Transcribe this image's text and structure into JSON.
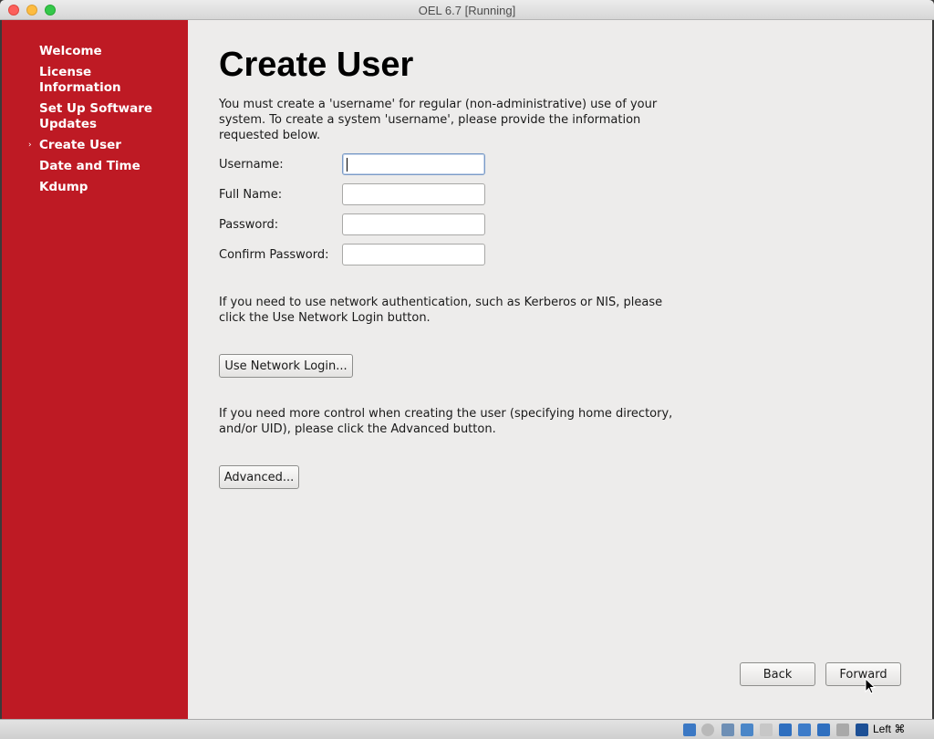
{
  "window": {
    "title": "OEL 6.7 [Running]"
  },
  "sidebar": {
    "items": [
      {
        "label": "Welcome"
      },
      {
        "label": "License Information"
      },
      {
        "label": "Set Up Software Updates"
      },
      {
        "label": "Create User",
        "current": true
      },
      {
        "label": "Date and Time"
      },
      {
        "label": "Kdump"
      }
    ],
    "current_marker": "›",
    "background_color": "#be1a24"
  },
  "main": {
    "title": "Create User",
    "intro": "You must create a 'username' for regular (non-administrative) use of your system.  To create a system 'username', please provide the information requested below.",
    "form": {
      "username_label": "Username:",
      "fullname_label": "Full Name:",
      "password_label": "Password:",
      "confirm_label": "Confirm Password:",
      "username_value": "",
      "fullname_value": "",
      "password_value": "",
      "confirm_value": ""
    },
    "network_text": "If you need to use network authentication, such as Kerberos or NIS, please click the Use Network Login button.",
    "network_button": "Use Network Login...",
    "advanced_text": "If you need more control when creating the user (specifying home directory, and/or UID), please click the Advanced button.",
    "advanced_button": "Advanced..."
  },
  "footer": {
    "back_label": "Back",
    "forward_label": "Forward"
  },
  "statusbar": {
    "host_key": "Left ⌘"
  }
}
